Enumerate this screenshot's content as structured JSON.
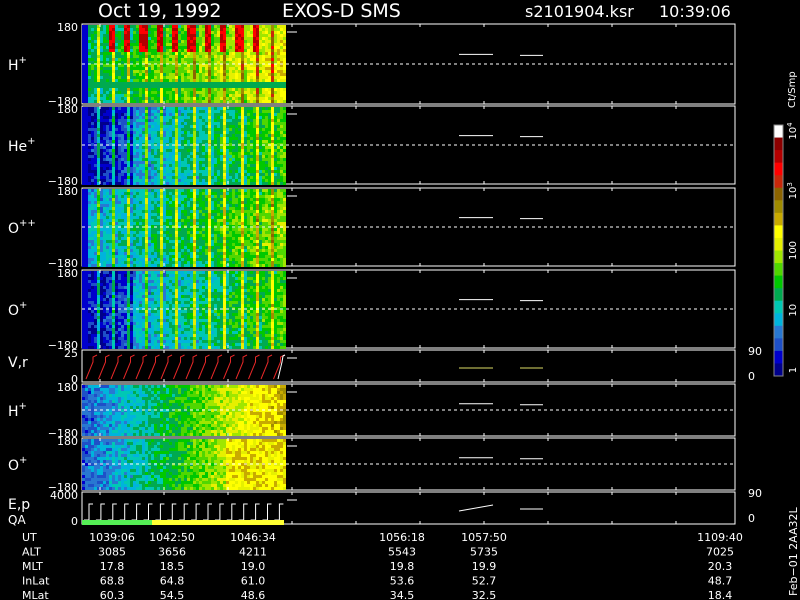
{
  "header": {
    "date": "Oct 19, 1992",
    "instrument": "EXOS-D SMS",
    "file": "s2101904.ksr",
    "time": "10:39:06"
  },
  "colorbar": {
    "unit": "Ct/Smp",
    "ticks": [
      {
        "label": "1",
        "value": 1
      },
      {
        "label": "10",
        "value": 10
      },
      {
        "label": "100",
        "value": 100
      },
      {
        "label": "10",
        "sup": "3",
        "value": 1000
      },
      {
        "label": "10",
        "sup": "4",
        "value": 10000
      }
    ],
    "colors": [
      "#00008b",
      "#0000cd",
      "#1e50c8",
      "#2878d2",
      "#00b4dc",
      "#00c8b4",
      "#00aa50",
      "#00c800",
      "#50d700",
      "#a0e600",
      "#e6f000",
      "#ffff00",
      "#c8aa00",
      "#a08c00",
      "#8c6400",
      "#c8280a",
      "#ff0000",
      "#b40000",
      "#8b0000",
      "#ffffff"
    ]
  },
  "panels": [
    {
      "id": "h1",
      "species": "H",
      "charge": "+",
      "ytop": "180",
      "ybot": "−180",
      "plot": "spectrogram",
      "style": "h1"
    },
    {
      "id": "he",
      "species": "He",
      "charge": "+",
      "ytop": "180",
      "ybot": "−180",
      "plot": "spectrogram",
      "style": "he"
    },
    {
      "id": "opp",
      "species": "O",
      "charge": "++",
      "ytop": "180",
      "ybot": "−180",
      "plot": "spectrogram",
      "style": "opp"
    },
    {
      "id": "op",
      "species": "O",
      "charge": "+",
      "ytop": "180",
      "ybot": "−180",
      "plot": "spectrogram",
      "style": "op"
    },
    {
      "id": "vr",
      "species": "V,r",
      "charge": "",
      "ytop": "25",
      "ybot": "0",
      "rtop": "90",
      "rbot": "0",
      "plot": "line"
    },
    {
      "id": "h2",
      "species": "H",
      "charge": "+",
      "ytop": "180",
      "ybot": "−180",
      "plot": "spectrogram",
      "style": "h2"
    },
    {
      "id": "o2",
      "species": "O",
      "charge": "+",
      "ytop": "180",
      "ybot": "−180",
      "plot": "spectrogram",
      "style": "o2"
    },
    {
      "id": "ep",
      "species": "E,p",
      "charge": "",
      "ytop": "4000",
      "ybot": "0",
      "rtop": "90",
      "rbot": "0",
      "plot": "line"
    }
  ],
  "qa_label": "QA",
  "orbit": {
    "rows": [
      {
        "label": "UT",
        "values": [
          "1039:06",
          "1042:50",
          "1046:34",
          "1056:18",
          "1057:50",
          "1109:40"
        ]
      },
      {
        "label": "ALT",
        "values": [
          "3085",
          "3656",
          "4211",
          "5543",
          "5735",
          "7025"
        ]
      },
      {
        "label": "MLT",
        "values": [
          "17.8",
          "18.5",
          "19.0",
          "19.8",
          "19.9",
          "20.3"
        ]
      },
      {
        "label": "InLat",
        "values": [
          "68.8",
          "64.8",
          "61.0",
          "53.6",
          "52.7",
          "48.7"
        ]
      },
      {
        "label": "MLat",
        "values": [
          "60.3",
          "54.5",
          "48.6",
          "34.5",
          "32.5",
          "18.4"
        ]
      }
    ]
  },
  "footer_side": "Feb−01 2AA32L",
  "chart_data": {
    "type": "heatmap",
    "title": "Oct 19, 1992 EXOS-D SMS",
    "x_ticks": [
      "1039:06",
      "1042:50",
      "1046:34",
      "1056:18",
      "1057:50",
      "1109:40"
    ],
    "data_end_ut": "1047:48",
    "pitch_angle_range": [
      -180,
      180
    ],
    "count_scale": "log",
    "count_range": [
      1,
      10000
    ],
    "panels": [
      "H+",
      "He+",
      "O++",
      "O+",
      "V,r",
      "H+",
      "O+",
      "E,p"
    ],
    "qa": "QA"
  }
}
